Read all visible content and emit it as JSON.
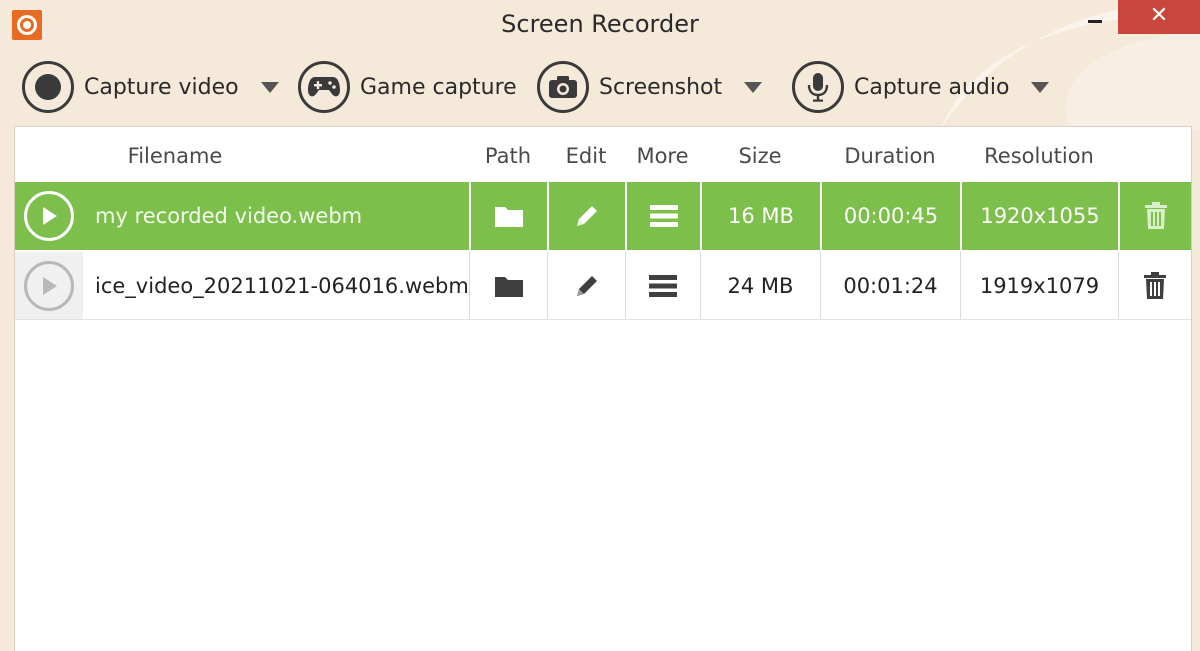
{
  "window": {
    "title": "Screen Recorder",
    "close_label": "✕"
  },
  "toolbar": {
    "capture_video": "Capture video",
    "game_capture": "Game capture",
    "screenshot": "Screenshot",
    "capture_audio": "Capture audio"
  },
  "table": {
    "headers": {
      "filename": "Filename",
      "path": "Path",
      "edit": "Edit",
      "more": "More",
      "size": "Size",
      "duration": "Duration",
      "resolution": "Resolution"
    },
    "rows": [
      {
        "filename": "my recorded video.webm",
        "size": "16 MB",
        "duration": "00:00:45",
        "resolution": "1920x1055",
        "selected": true
      },
      {
        "filename": "ice_video_20211021-064016.webm",
        "size": "24 MB",
        "duration": "00:01:24",
        "resolution": "1919x1079",
        "selected": false
      }
    ]
  },
  "colors": {
    "accent": "#7cbf4a",
    "background": "#f5e9da",
    "close": "#c9463d",
    "app_icon": "#e96a22"
  },
  "icons": {
    "app": "record-icon",
    "capture_video": "record-circle-icon",
    "game_capture": "gamepad-icon",
    "screenshot": "camera-icon",
    "capture_audio": "microphone-icon",
    "path": "folder-icon",
    "edit": "pencil-icon",
    "more": "menu-icon",
    "delete": "trash-icon",
    "play": "play-icon"
  }
}
